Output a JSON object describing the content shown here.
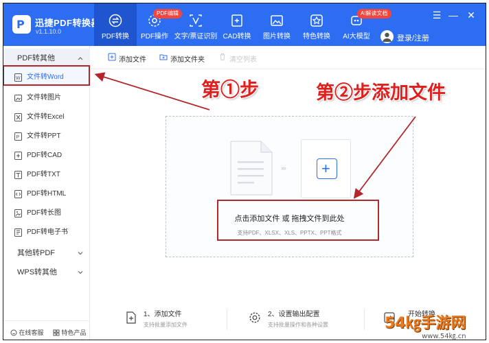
{
  "app": {
    "title": "迅捷PDF转换器",
    "version": "v1.1.10.0"
  },
  "nav": {
    "tabs": [
      {
        "label": "PDF转换",
        "icon": "swap-icon",
        "active": true
      },
      {
        "label": "PDF操作",
        "icon": "gear-icon",
        "badge": "PDF编辑"
      },
      {
        "label": "文字/票证识别",
        "icon": "scan-icon"
      },
      {
        "label": "CAD转换",
        "icon": "cad-icon"
      },
      {
        "label": "图片转换",
        "icon": "image-icon"
      },
      {
        "label": "特色转换",
        "icon": "star-icon"
      },
      {
        "label": "AI大模型",
        "icon": "ai-icon",
        "badge": "AI解读文档"
      }
    ],
    "login": "登录/注册"
  },
  "sidebar": {
    "group_open": "PDF转其他",
    "items": [
      {
        "label": "文件转Word",
        "icon": "word-icon",
        "active": true
      },
      {
        "label": "文件转图片",
        "icon": "image-icon"
      },
      {
        "label": "文件转Excel",
        "icon": "excel-icon"
      },
      {
        "label": "文件转PPT",
        "icon": "ppt-icon"
      },
      {
        "label": "PDF转CAD",
        "icon": "cad-icon"
      },
      {
        "label": "PDF转TXT",
        "icon": "txt-icon"
      },
      {
        "label": "PDF转HTML",
        "icon": "html-icon"
      },
      {
        "label": "PDF转长图",
        "icon": "long-image-icon"
      },
      {
        "label": "PDF转电子书",
        "icon": "ebook-icon"
      }
    ],
    "group_other": "其他转PDF",
    "group_wps": "WPS转其他",
    "bottom": {
      "service": "在线客服",
      "products": "特色产品"
    }
  },
  "toolbar": {
    "add_file": "添加文件",
    "add_folder": "添加文件夹",
    "clear_list": "清空列表"
  },
  "dropzone": {
    "main": "点击添加文件 或 拖拽文件到此处",
    "sub": "支持PDF、XLSX、XLS、PPTX、PPT格式"
  },
  "annotations": {
    "step1": "第①步",
    "step2": "第②步添加文件"
  },
  "steps": [
    {
      "title": "1、添加文件",
      "sub": "支持批量添加文件"
    },
    {
      "title": "2、设置输出配置",
      "sub": "支持批量操作和各种设置"
    },
    {
      "title": "开始转换",
      "sub": ""
    }
  ],
  "watermark": {
    "text": "54㎏手游网",
    "url": "www.54㎏.cn"
  },
  "colors": {
    "brand": "#2c6df2",
    "annotation_red": "#e0201f",
    "badge_red": "#f2453d"
  }
}
